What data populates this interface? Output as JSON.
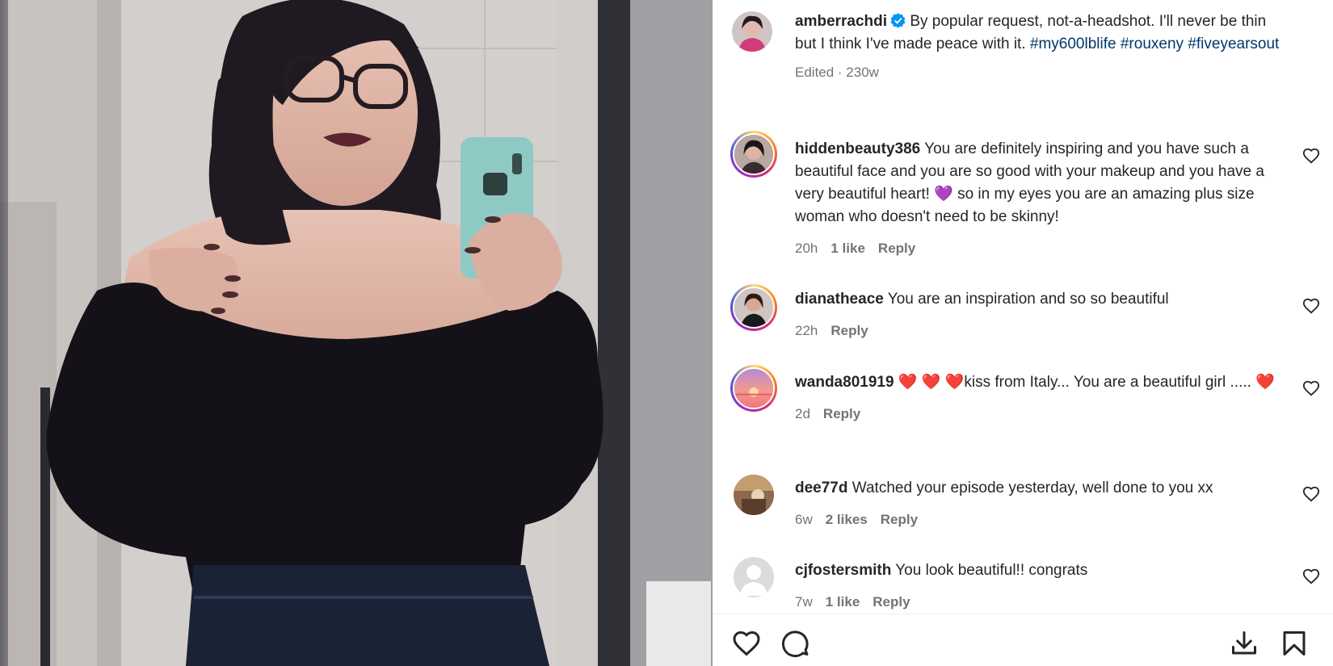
{
  "post": {
    "author": "amberrachdi",
    "verified": true,
    "caption": "By popular request, not-a-headshot. I'll never be thin but I think I've made peace with it.",
    "hashtags": [
      "#my600lblife",
      "#rouxeny",
      "#fiveyearsout"
    ],
    "meta": "Edited · 230w"
  },
  "comments": [
    {
      "user": "hiddenbeauty386",
      "text": "You are definitely inspiring and you have such a beautiful face and you are so good with your makeup and you have a very beautiful heart! 💜 so in my eyes you are an amazing plus size woman who doesn't need to be skinny!",
      "time": "20h",
      "likes": "1 like",
      "reply": "Reply"
    },
    {
      "user": "dianatheace",
      "text": "You are an inspiration and so so beautiful",
      "time": "22h",
      "likes": "",
      "reply": "Reply"
    },
    {
      "user": "wanda801919",
      "text": "❤️ ❤️ ❤️kiss from Italy... You are a beautiful girl ..... ❤️",
      "time": "2d",
      "likes": "",
      "reply": "Reply"
    },
    {
      "user": "dee77d",
      "text": "Watched your episode yesterday, well done to you xx",
      "time": "6w",
      "likes": "2 likes",
      "reply": "Reply"
    },
    {
      "user": "cjfostersmith",
      "text": "You look beautiful!! congrats",
      "time": "7w",
      "likes": "1 like",
      "reply": "Reply"
    }
  ],
  "icons": {
    "like": "heart-icon",
    "comment": "comment-icon",
    "save": "bookmark-icon",
    "download": "download-icon",
    "comment_like": "heart-icon"
  },
  "colors": {
    "hashtag": "#00376b",
    "meta": "#737373",
    "verified": "#0095f6",
    "heart_emoji": "#ed1c24",
    "purple_heart": "#8e44ad"
  }
}
